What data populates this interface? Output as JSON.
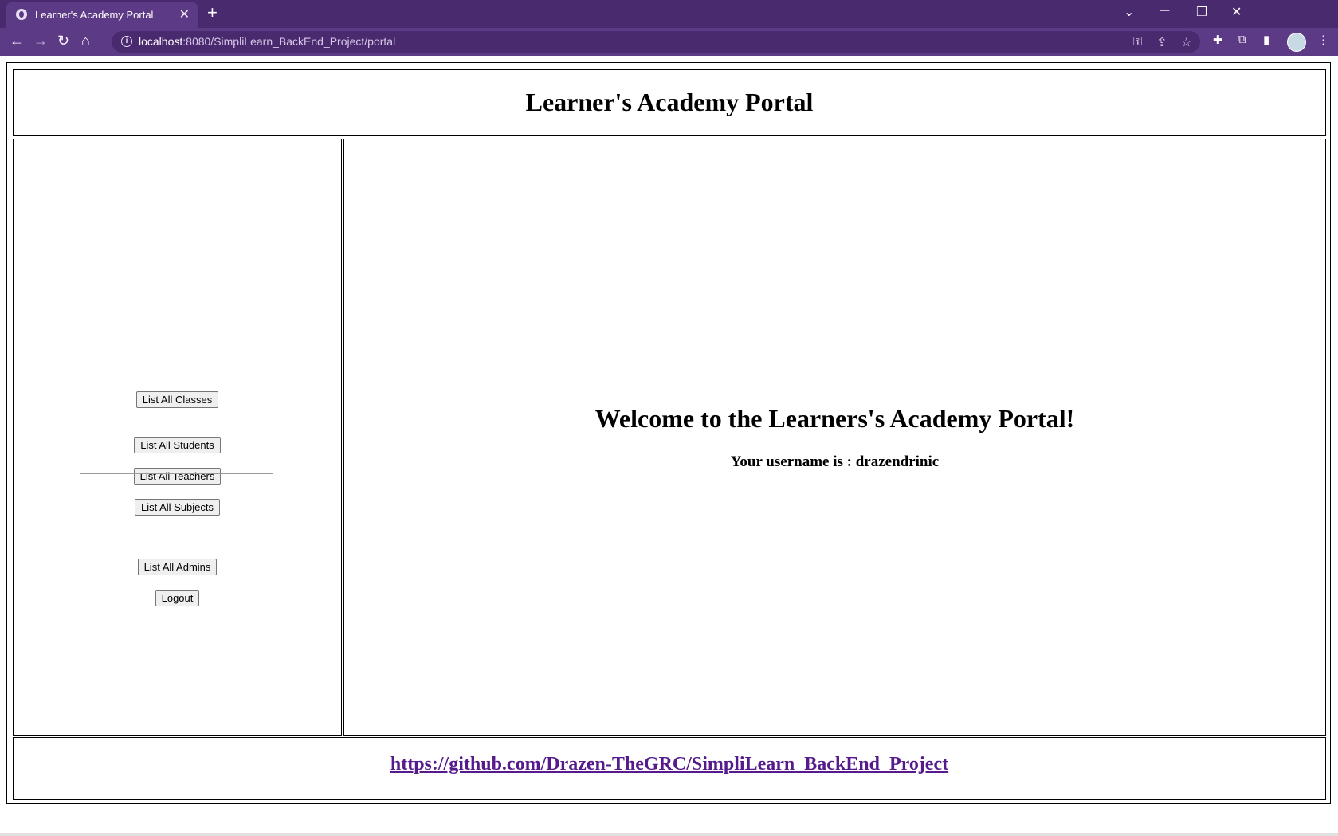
{
  "browser": {
    "tab": {
      "title": "Learner's Academy Portal"
    },
    "url": {
      "host": "localhost",
      "rest": ":8080/SimpliLearn_BackEnd_Project/portal"
    },
    "theme": {
      "frame": "#4a2a6e",
      "toolbar": "#5d3a86"
    },
    "icons": {
      "close": "✕",
      "new_tab": "+",
      "tab_list": "⌄",
      "minimize": "─",
      "restore": "❐",
      "window_close": "✕",
      "back": "←",
      "forward": "→",
      "reload": "↻",
      "home": "⌂",
      "info": "i",
      "key": "⚿",
      "share": "⇪",
      "star": "☆",
      "extension": "✚",
      "puzzle": "⧉",
      "sidepanel": "▮",
      "menu": "⋮"
    }
  },
  "page": {
    "title": "Learner's Academy Portal",
    "nav": {
      "list_classes": "List All Classes",
      "list_students": "List All Students",
      "list_teachers": "List All Teachers",
      "list_subjects": "List All Subjects",
      "list_admins": "List All Admins",
      "logout": "Logout"
    },
    "welcome": "Welcome to the Learners's Academy Portal!",
    "username_line": "Your username is : drazendrinic",
    "footer_link": "https://github.com/Drazen-TheGRC/SimpliLearn_BackEnd_Project",
    "link_color": "#551a8b"
  }
}
